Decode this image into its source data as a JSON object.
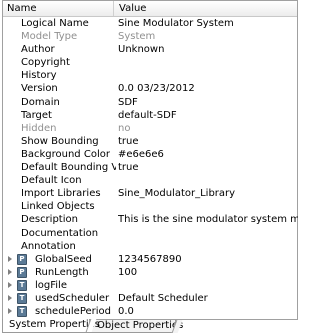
{
  "header": {
    "name_label": "Name",
    "value_label": "Value"
  },
  "rows": [
    {
      "name": "Logical Name",
      "value": "Sine Modulator System",
      "disabled": false
    },
    {
      "name": "Model Type",
      "value": "System",
      "disabled": true
    },
    {
      "name": "Author",
      "value": "Unknown",
      "disabled": false
    },
    {
      "name": "Copyright",
      "value": "",
      "disabled": false
    },
    {
      "name": "History",
      "value": "",
      "disabled": false
    },
    {
      "name": "Version",
      "value": "0.0 03/23/2012",
      "disabled": false
    },
    {
      "name": "Domain",
      "value": "SDF",
      "disabled": false
    },
    {
      "name": "Target",
      "value": "default-SDF",
      "disabled": false
    },
    {
      "name": "Hidden",
      "value": "no",
      "disabled": true
    },
    {
      "name": "Show Bounding",
      "value": "true",
      "disabled": false
    },
    {
      "name": "Background Color",
      "value": "#e6e6e6",
      "disabled": false
    },
    {
      "name": "Default Bounding Visible",
      "value": "true",
      "disabled": false
    },
    {
      "name": "Default Icon",
      "value": "",
      "disabled": false
    },
    {
      "name": "Import Libraries",
      "value": "Sine_Modulator_Library",
      "disabled": false
    },
    {
      "name": "Linked Objects",
      "value": "",
      "disabled": false
    },
    {
      "name": "Description",
      "value": "This is the sine modulator system model.",
      "disabled": false
    },
    {
      "name": "Documentation",
      "value": "",
      "disabled": false
    },
    {
      "name": "Annotation",
      "value": "",
      "disabled": false
    }
  ],
  "params": [
    {
      "name": "GlobalSeed",
      "value": "1234567890",
      "icon": "P"
    },
    {
      "name": "RunLength",
      "value": "100",
      "icon": "P"
    },
    {
      "name": "logFile",
      "value": "",
      "icon": "T"
    },
    {
      "name": "usedScheduler",
      "value": "Default Scheduler",
      "icon": "T"
    },
    {
      "name": "schedulePeriod",
      "value": "0.0",
      "icon": "T"
    }
  ],
  "tabs": [
    {
      "label": "System Properties",
      "active": true
    },
    {
      "label": "Object Properties",
      "active": false
    }
  ]
}
